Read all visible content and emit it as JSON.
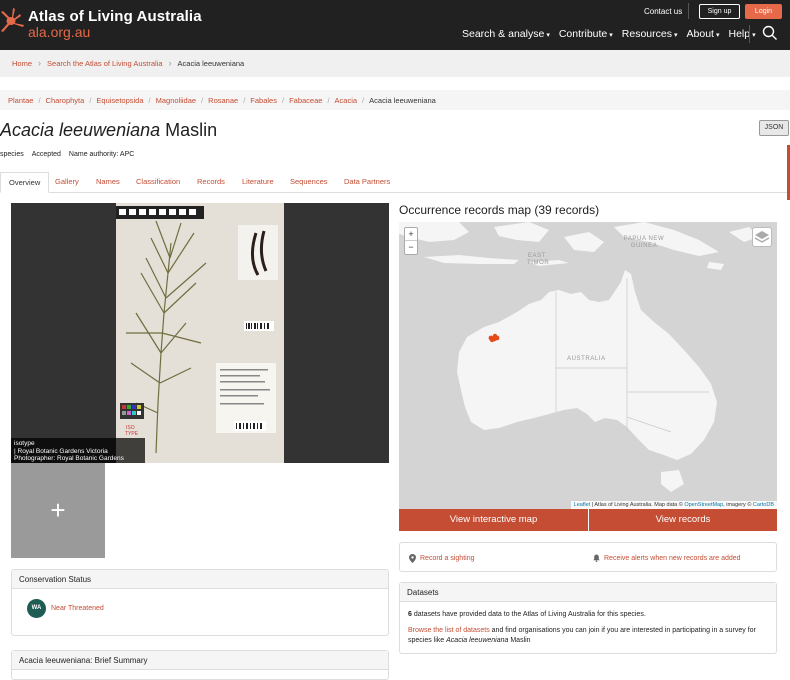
{
  "header": {
    "brand_title": "Atlas of Living Australia",
    "brand_url": "ala.org.au",
    "contact": "Contact us",
    "signup": "Sign up",
    "login": "Login",
    "nav": [
      {
        "label": "Search & analyse"
      },
      {
        "label": "Contribute"
      },
      {
        "label": "Resources"
      },
      {
        "label": "About"
      },
      {
        "label": "Help"
      }
    ],
    "accent": "#e66a4a"
  },
  "breadcrumb": {
    "home": "Home",
    "search": "Search the Atlas of Living Australia",
    "current": "Acacia leeuweniana"
  },
  "taxonomy": {
    "items": [
      "Plantae",
      "Charophyta",
      "Equisetopsida",
      "Magnoliidae",
      "Rosanae",
      "Fabales",
      "Fabaceae",
      "Acacia"
    ],
    "current": "Acacia leeuweniana"
  },
  "species": {
    "name": "Acacia leeuweniana",
    "author": "Maslin",
    "json_button": "JSON",
    "rank": "species",
    "status": "Accepted",
    "authority_label": "Name authority:",
    "authority_value": "APC"
  },
  "tabs": [
    "Overview",
    "Gallery",
    "Names",
    "Classification",
    "Records",
    "Literature",
    "Sequences",
    "Data Partners"
  ],
  "image": {
    "caption_line1": "isotype",
    "caption_line2": "| Royal Botanic Gardens Victoria",
    "caption_line3": "Photographer: Royal Botanic Gardens Victoria",
    "add_symbol": "+"
  },
  "conservation": {
    "heading": "Conservation Status",
    "badge": "WA",
    "status": "Near Threatened"
  },
  "brief": {
    "heading": "Acacia leeuweniana: Brief Summary"
  },
  "map": {
    "title": "Occurrence records map (39 records)",
    "zoom_in": "+",
    "zoom_out": "−",
    "label_png": "PAPUA NEW GUINEA",
    "label_timor": "EAST TIMOR",
    "label_aus": "AUSTRALIA",
    "attrib_leaflet": "Leaflet",
    "attrib_text1": " | Atlas of Living Australia. Map data © ",
    "attrib_osm": "OpenStreetMap",
    "attrib_text2": ", imagery © ",
    "attrib_carto": "CartoDB",
    "btn_interactive": "View interactive map",
    "btn_records": "View records"
  },
  "actions": {
    "sighting": "Record a sighting",
    "alerts": "Receive alerts when new records are added"
  },
  "datasets": {
    "heading": "Datasets",
    "count": "6",
    "count_text": " datasets have provided data to the Atlas of Living Australia for this species.",
    "browse_link": "Browse the list of datasets",
    "browse_text": " and find organisations you can join if you are interested in participating in a survey for species like ",
    "species_italic": "Acacia leeuweniana",
    "species_author": " Maslin"
  }
}
